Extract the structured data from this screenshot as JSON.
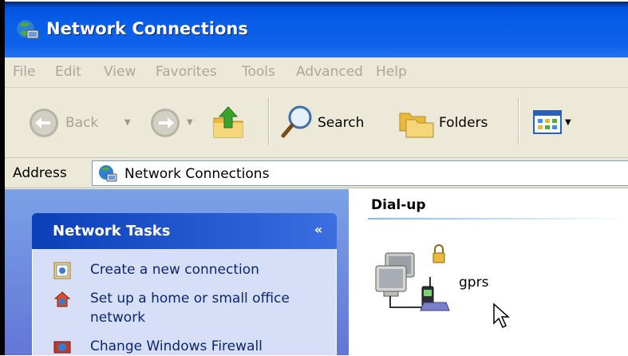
{
  "window": {
    "title": "Network Connections"
  },
  "menu": [
    "File",
    "Edit",
    "View",
    "Favorites",
    "Tools",
    "Advanced",
    "Help"
  ],
  "toolbar": {
    "back_label": "Back",
    "search_label": "Search",
    "folders_label": "Folders"
  },
  "address": {
    "label": "Address",
    "value": "Network Connections"
  },
  "task_pane": {
    "title": "Network Tasks",
    "items": [
      {
        "label": "Create a new connection",
        "icon": "new-connection-icon"
      },
      {
        "label": "Set up a home or small office network",
        "icon": "home-network-icon"
      },
      {
        "label": "Change Windows Firewall",
        "icon": "firewall-icon"
      }
    ]
  },
  "content": {
    "group_title": "Dial-up",
    "connection": {
      "name": "gprs",
      "icon": "dialup-connection-icon"
    }
  },
  "colors": {
    "title_blue": "#0054e3",
    "menu_bg": "#ece9d8",
    "task_header": "#0a3fb8",
    "task_body": "#d6dff7",
    "link_blue": "#0c266f"
  }
}
